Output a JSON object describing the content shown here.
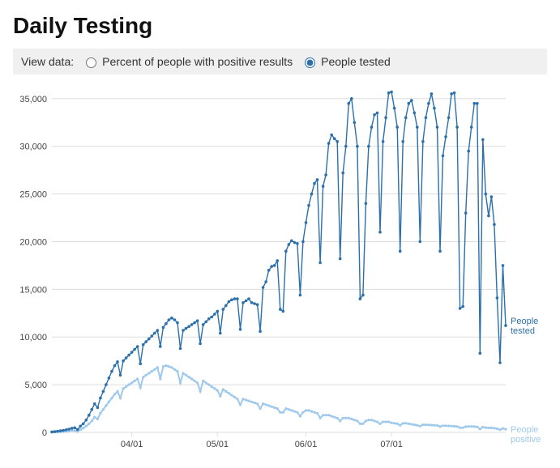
{
  "title": "Daily Testing",
  "controls": {
    "label": "View data:",
    "option_percent": "Percent of people with positive results",
    "option_tested": "People tested",
    "selected": "tested"
  },
  "chart_data": {
    "type": "line",
    "xlabel": "",
    "ylabel": "",
    "ylim": [
      0,
      36000
    ],
    "y_ticks": [
      0,
      5000,
      10000,
      15000,
      20000,
      25000,
      30000,
      35000
    ],
    "y_tick_labels": [
      "0",
      "5,000",
      "10,000",
      "15,000",
      "20,000",
      "25,000",
      "30,000",
      "35,000"
    ],
    "x_start": "2020-03-04",
    "x_tick_dates": [
      "2020-04-01",
      "2020-05-01",
      "2020-06-01",
      "2020-07-01"
    ],
    "x_tick_labels": [
      "04/01",
      "05/01",
      "06/01",
      "07/01"
    ],
    "series": [
      {
        "name": "People tested",
        "color": "#2b6fab",
        "values": [
          50,
          80,
          120,
          160,
          210,
          270,
          340,
          430,
          480,
          300,
          650,
          900,
          1300,
          1800,
          2400,
          3000,
          2600,
          3600,
          4300,
          5000,
          5700,
          6400,
          7000,
          7400,
          6000,
          7500,
          7800,
          8100,
          8400,
          8700,
          9000,
          7200,
          9200,
          9500,
          9800,
          10100,
          10400,
          10700,
          9000,
          11000,
          11400,
          11800,
          12000,
          11800,
          11500,
          8800,
          10700,
          10900,
          11100,
          11300,
          11500,
          11700,
          9300,
          11300,
          11600,
          11900,
          12100,
          12400,
          12700,
          10400,
          12900,
          13300,
          13700,
          13900,
          14000,
          14000,
          10800,
          13600,
          13800,
          14000,
          13600,
          13500,
          13400,
          10600,
          15200,
          15800,
          17000,
          17400,
          17500,
          18000,
          12900,
          12700,
          19000,
          19700,
          20100,
          19900,
          19800,
          14400,
          20000,
          22000,
          23800,
          25000,
          26100,
          26500,
          17800,
          25800,
          27000,
          30300,
          31200,
          30800,
          30500,
          18200,
          27200,
          30000,
          34500,
          35000,
          32500,
          30000,
          14000,
          14400,
          24000,
          30000,
          32000,
          33300,
          33500,
          21000,
          30500,
          33000,
          35600,
          35700,
          34000,
          32000,
          19000,
          30500,
          33000,
          34500,
          34800,
          33500,
          32000,
          20000,
          30500,
          33000,
          34500,
          35500,
          34000,
          32000,
          19000,
          29000,
          31000,
          33000,
          35500,
          35600,
          32000,
          13000,
          13200,
          23000,
          29500,
          32000,
          34500,
          34500,
          8300,
          30700,
          25000,
          22700,
          24700,
          21800,
          14100,
          7300,
          17500,
          11200
        ]
      },
      {
        "name": "People positive",
        "color": "#9ec9ec",
        "values": [
          20,
          30,
          45,
          60,
          80,
          110,
          150,
          200,
          180,
          120,
          300,
          450,
          650,
          900,
          1200,
          1600,
          1400,
          2000,
          2400,
          2800,
          3200,
          3600,
          4000,
          4300,
          3600,
          4600,
          4800,
          5000,
          5200,
          5400,
          5600,
          4700,
          5800,
          6000,
          6200,
          6400,
          6600,
          6800,
          5600,
          6900,
          7000,
          6900,
          6800,
          6600,
          6400,
          5200,
          6200,
          6000,
          5800,
          5600,
          5400,
          5200,
          4300,
          5400,
          5200,
          5000,
          4800,
          4600,
          4400,
          3800,
          4500,
          4300,
          4100,
          3900,
          3700,
          3500,
          2900,
          3500,
          3400,
          3300,
          3200,
          3100,
          3000,
          2500,
          3000,
          2900,
          2800,
          2700,
          2600,
          2500,
          2100,
          2100,
          2500,
          2400,
          2300,
          2200,
          2100,
          1700,
          2100,
          2300,
          2300,
          2200,
          2100,
          2000,
          1500,
          1800,
          1800,
          1800,
          1700,
          1600,
          1500,
          1200,
          1500,
          1500,
          1500,
          1400,
          1300,
          1200,
          900,
          900,
          1200,
          1300,
          1300,
          1200,
          1100,
          900,
          1100,
          1100,
          1100,
          1000,
          950,
          900,
          750,
          950,
          950,
          900,
          850,
          800,
          750,
          650,
          800,
          800,
          780,
          760,
          740,
          720,
          600,
          700,
          700,
          680,
          660,
          640,
          620,
          480,
          480,
          600,
          620,
          620,
          600,
          580,
          350,
          550,
          500,
          470,
          470,
          440,
          380,
          280,
          420,
          330
        ]
      }
    ],
    "series_labels": {
      "tested": "People\ntested",
      "positive": "People\npositive"
    }
  }
}
